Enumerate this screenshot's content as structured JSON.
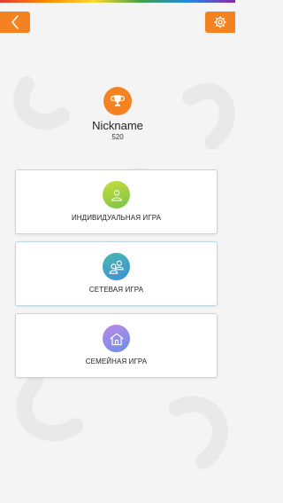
{
  "profile": {
    "nickname": "Nickname",
    "score": "520"
  },
  "modes": [
    {
      "label": "ИНДИВИДУАЛЬНАЯ ИГРА",
      "icon": "user-icon"
    },
    {
      "label": "СЕТЕВАЯ ИГРА",
      "icon": "users-icon"
    },
    {
      "label": "СЕМЕЙНАЯ ИГРА",
      "icon": "home-icon"
    }
  ],
  "colors": {
    "accent": "#f58220",
    "background": "#f4f4f4",
    "card_border": "#bcd7e6"
  }
}
